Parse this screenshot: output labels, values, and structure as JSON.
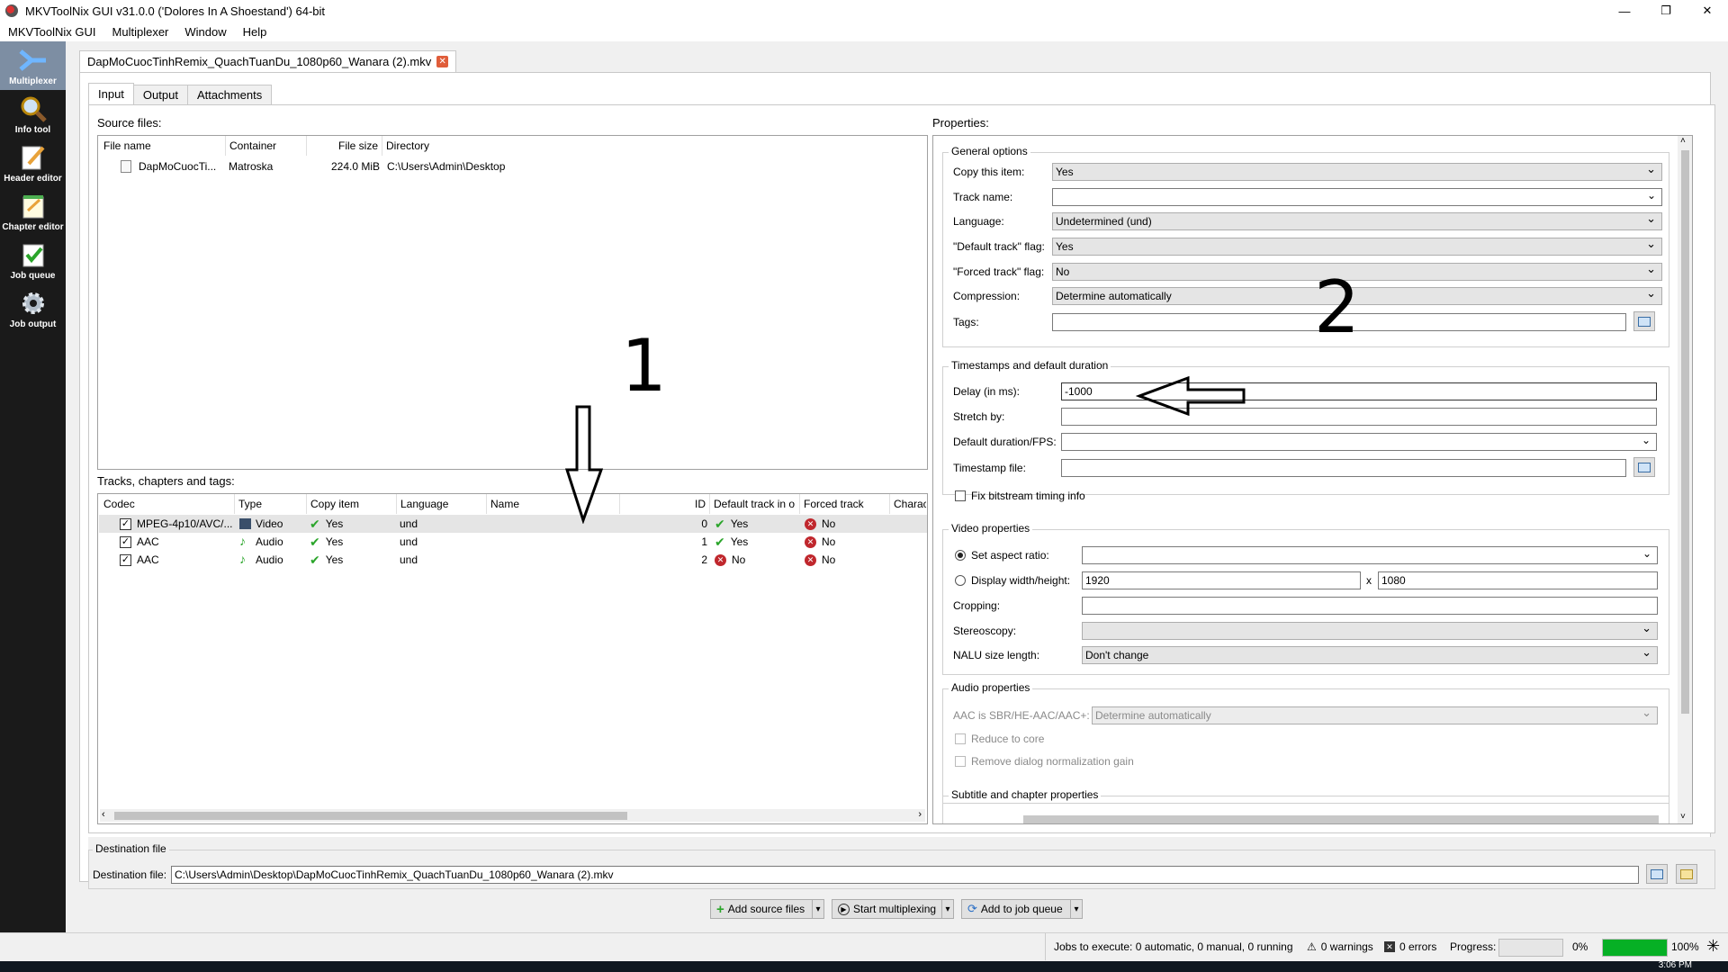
{
  "window": {
    "title": "MKVToolNix GUI v31.0.0 ('Dolores In A Shoestand') 64-bit",
    "minimize": "—",
    "maximize": "❐",
    "close": "✕"
  },
  "menu": [
    "MKVToolNix GUI",
    "Multiplexer",
    "Window",
    "Help"
  ],
  "sidebar": [
    {
      "label": "Multiplexer",
      "icon": "multiplexer-icon"
    },
    {
      "label": "Info tool",
      "icon": "magnifier-icon"
    },
    {
      "label": "Header editor",
      "icon": "pencil-icon"
    },
    {
      "label": "Chapter editor",
      "icon": "notepad-icon"
    },
    {
      "label": "Job queue",
      "icon": "checklist-icon"
    },
    {
      "label": "Job output",
      "icon": "gear-icon"
    }
  ],
  "file_tab": "DapMoCuocTinhRemix_QuachTuanDu_1080p60_Wanara (2).mkv",
  "subtabs": [
    "Input",
    "Output",
    "Attachments"
  ],
  "source_files": {
    "label": "Source files:",
    "headers": [
      "File name",
      "Container",
      "File size",
      "Directory"
    ],
    "rows": [
      {
        "name": "DapMoCuocTi...",
        "container": "Matroska",
        "size": "224.0 MiB",
        "dir": "C:\\Users\\Admin\\Desktop"
      }
    ]
  },
  "tracks": {
    "label": "Tracks, chapters and tags:",
    "headers": [
      "Codec",
      "Type",
      "Copy item",
      "Language",
      "Name",
      "ID",
      "Default track in o",
      "Forced track",
      "Charac"
    ],
    "rows": [
      {
        "codec": "MPEG-4p10/AVC/...",
        "type": "Video",
        "copy": "Yes",
        "lang": "und",
        "id": "0",
        "default": "Yes",
        "forced": "No"
      },
      {
        "codec": "AAC",
        "type": "Audio",
        "copy": "Yes",
        "lang": "und",
        "id": "1",
        "default": "Yes",
        "forced": "No"
      },
      {
        "codec": "AAC",
        "type": "Audio",
        "copy": "Yes",
        "lang": "und",
        "id": "2",
        "default": "No",
        "forced": "No"
      }
    ]
  },
  "properties": {
    "label": "Properties:",
    "general": {
      "title": "General options",
      "copy_label": "Copy this item:",
      "copy_value": "Yes",
      "track_name_label": "Track name:",
      "track_name_value": "",
      "language_label": "Language:",
      "language_value": "Undetermined (und)",
      "default_label": "\"Default track\" flag:",
      "default_value": "Yes",
      "forced_label": "\"Forced track\" flag:",
      "forced_value": "No",
      "compression_label": "Compression:",
      "compression_value": "Determine automatically",
      "tags_label": "Tags:",
      "tags_value": ""
    },
    "timestamps": {
      "title": "Timestamps and default duration",
      "delay_label": "Delay (in ms):",
      "delay_value": "-1000",
      "stretch_label": "Stretch by:",
      "stretch_value": "",
      "duration_label": "Default duration/FPS:",
      "duration_value": "",
      "tsfile_label": "Timestamp file:",
      "tsfile_value": "",
      "fix_label": "Fix bitstream timing info"
    },
    "video": {
      "title": "Video properties",
      "aspect_label": "Set aspect ratio:",
      "aspect_value": "",
      "dims_label": "Display width/height:",
      "width_value": "1920",
      "x_sep": "x",
      "height_value": "1080",
      "crop_label": "Cropping:",
      "crop_value": "",
      "stereo_label": "Stereoscopy:",
      "stereo_value": "",
      "nalu_label": "NALU size length:",
      "nalu_value": "Don't change"
    },
    "audio": {
      "title": "Audio properties",
      "sbr_label": "AAC is SBR/HE-AAC/AAC+:",
      "sbr_value": "Determine automatically",
      "core_label": "Reduce to core",
      "dialog_label": "Remove dialog normalization gain"
    },
    "subtitle": {
      "title": "Subtitle and chapter properties"
    }
  },
  "destination": {
    "group_title": "Destination file",
    "label": "Destination file:",
    "value": "C:\\Users\\Admin\\Desktop\\DapMoCuocTinhRemix_QuachTuanDu_1080p60_Wanara (2).mkv"
  },
  "actions": {
    "add_source": "Add source files",
    "start_mux": "Start multiplexing",
    "add_queue": "Add to job queue",
    "dropdown": "▾"
  },
  "status": {
    "jobs": "Jobs to execute:  0 automatic, 0 manual, 0 running",
    "warnings": "0 warnings",
    "errors": "0 errors",
    "progress_label": "Progress:",
    "progress_value": "0%",
    "total_value": "100%",
    "total_fraction": 1.0
  },
  "annotations": {
    "one": "1",
    "two": "2"
  },
  "clock": "3:06 PM"
}
